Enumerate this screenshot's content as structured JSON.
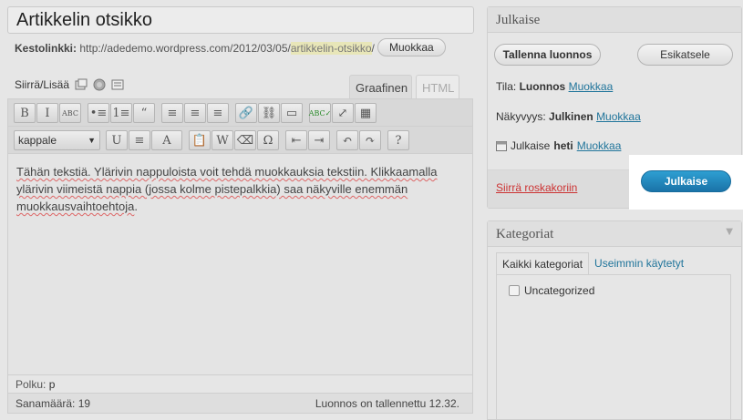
{
  "post": {
    "title": "Artikkelin otsikko",
    "permalink_label": "Kestolinkki:",
    "permalink_base": "http://adedemo.wordpress.com/2012/03/05/",
    "permalink_slug": "artikkelin-otsikko",
    "permalink_trailing": "/",
    "permalink_edit": "Muokkaa"
  },
  "media": {
    "label": "Siirrä/Lisää"
  },
  "editor_tabs": {
    "visual": "Graafinen",
    "html": "HTML"
  },
  "toolbar": {
    "row1": [
      "B",
      "I",
      "ABC",
      "•≡",
      "1≡",
      "“",
      "≡",
      "≡",
      "≡",
      "🔗",
      "⛓",
      "▭",
      "ABC✓",
      "⤢",
      "▦"
    ],
    "format_select": "kappale",
    "row2": [
      "U",
      "≡",
      "A",
      "📋",
      "W",
      "⌫",
      "Ω",
      "⇤",
      "⇥",
      "↶",
      "↷",
      "?"
    ]
  },
  "content": {
    "text_parts": [
      {
        "t": "Tähän tekstiä. Ylärivin nappuloista voit tehdä muokkauksia tekstiin. Klikkaamalla ylärivin viimeistä nappia (jossa kolme pistepalkkia) saa näkyville enemmän muokkausvaihtoehtoja",
        "u": true
      },
      {
        "t": ".",
        "u": false
      }
    ]
  },
  "path": {
    "label": "Polku:",
    "value": "p"
  },
  "status": {
    "wordcount": "Sanamäärä: 19",
    "saved": "Luonnos on tallennettu 12.32."
  },
  "publish": {
    "header": "Julkaise",
    "save_draft": "Tallenna luonnos",
    "preview": "Esikatsele",
    "status_label": "Tila:",
    "status_value": "Luonnos",
    "status_edit": "Muokkaa",
    "visibility_label": "Näkyvyys:",
    "visibility_value": "Julkinen",
    "visibility_edit": "Muokkaa",
    "schedule_label": "Julkaise",
    "schedule_value": "heti",
    "schedule_edit": "Muokkaa",
    "trash": "Siirrä roskakoriin",
    "publish_button": "Julkaise"
  },
  "categories": {
    "header": "Kategoriat",
    "tab_all": "Kaikki kategoriat",
    "tab_popular": "Useimmin käytetyt",
    "items": [
      "Uncategorized"
    ]
  }
}
